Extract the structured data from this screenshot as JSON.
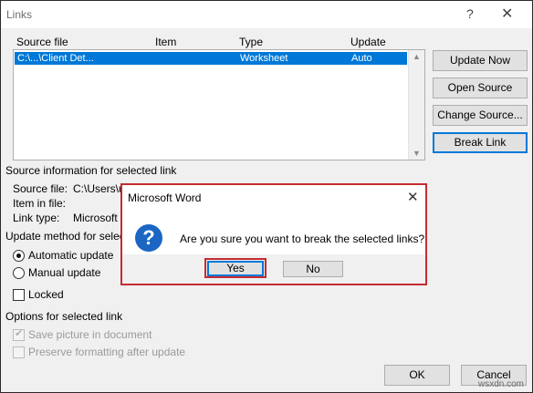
{
  "window": {
    "title": "Links",
    "help_glyph": "?",
    "close_glyph": "✕"
  },
  "links_table": {
    "headers": [
      "Source file",
      "Item",
      "Type",
      "Update"
    ],
    "rows": [
      {
        "source": "C:\\...\\Client Det...",
        "item": "",
        "type": "Worksheet",
        "update": "Auto"
      }
    ]
  },
  "buttons": {
    "update_now": "Update Now",
    "open_source": "Open Source",
    "change_source": "Change Source...",
    "break_link": "Break Link",
    "ok": "OK",
    "cancel": "Cancel"
  },
  "source_info": {
    "heading": "Source information for selected link",
    "source_file_label": "Source file:",
    "source_file_value": "C:\\Users\\u",
    "item_in_file_label": "Item in file:",
    "link_type_label": "Link type:",
    "link_type_value": "Microsoft"
  },
  "update_method": {
    "heading": "Update method for selec",
    "automatic": "Automatic update",
    "manual": "Manual update",
    "locked": "Locked",
    "selected": "automatic"
  },
  "options": {
    "heading": "Options for selected link",
    "save_picture": "Save picture in document",
    "preserve_formatting": "Preserve formatting after update"
  },
  "message_box": {
    "title": "Microsoft Word",
    "close_glyph": "✕",
    "icon_glyph": "?",
    "text": "Are you sure you want to break the selected links?",
    "yes": "Yes",
    "no": "No"
  },
  "watermark": "wsxdn.com",
  "colors": {
    "selection": "#0078d7",
    "highlight_red": "#c42b32",
    "icon_blue": "#1a66c2"
  }
}
